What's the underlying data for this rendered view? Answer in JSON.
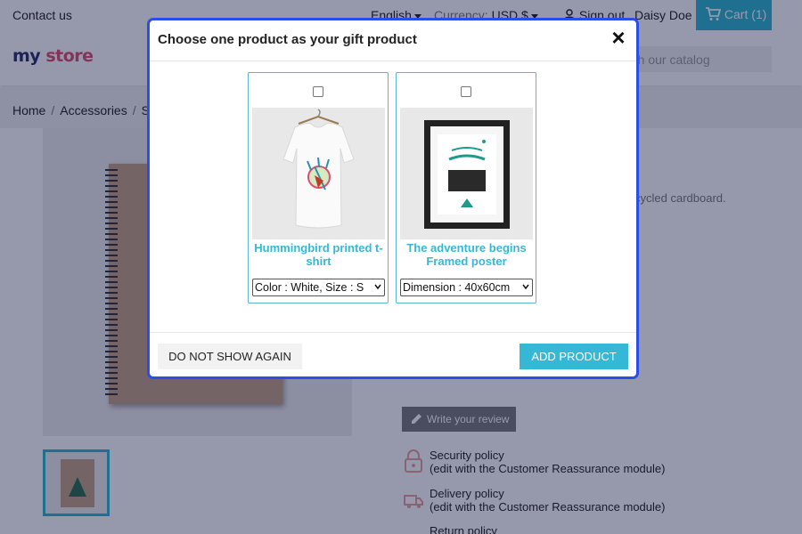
{
  "topbar": {
    "contact": "Contact us",
    "language": "English",
    "currency_label": "Currency:",
    "currency_value": "USD $",
    "sign_out": "Sign out",
    "user_name": "Daisy Doe",
    "cart": "Cart",
    "cart_count": "(1)"
  },
  "header": {
    "logo_a": "my ",
    "logo_b": "store",
    "search_placeholder": "rch our catalog"
  },
  "breadcrumb": {
    "items": [
      "Home",
      "Accessories",
      "S"
    ]
  },
  "product": {
    "desc_fragment": "cycled cardboard.",
    "review_button": "Write your review",
    "reassurance": [
      {
        "title": "Security policy",
        "sub": "(edit with the Customer Reassurance module)",
        "icon": "lock-icon"
      },
      {
        "title": "Delivery policy",
        "sub": "(edit with the Customer Reassurance module)",
        "icon": "truck-icon"
      },
      {
        "title": "Return policy",
        "sub": "",
        "icon": "return-icon"
      }
    ]
  },
  "modal": {
    "title": "Choose one product as your gift product",
    "close": "×",
    "products": [
      {
        "name": "Hummingbird printed t-shirt",
        "option": "Color : White, Size : S",
        "checked": false
      },
      {
        "name": "The adventure begins Framed poster",
        "option": "Dimension : 40x60cm",
        "checked": false
      }
    ],
    "dont_show": "DO NOT SHOW AGAIN",
    "add": "ADD PRODUCT"
  },
  "colors": {
    "accent": "#2fb5d2",
    "modal_border": "#2b4de8",
    "overlay": "#0c123c"
  }
}
